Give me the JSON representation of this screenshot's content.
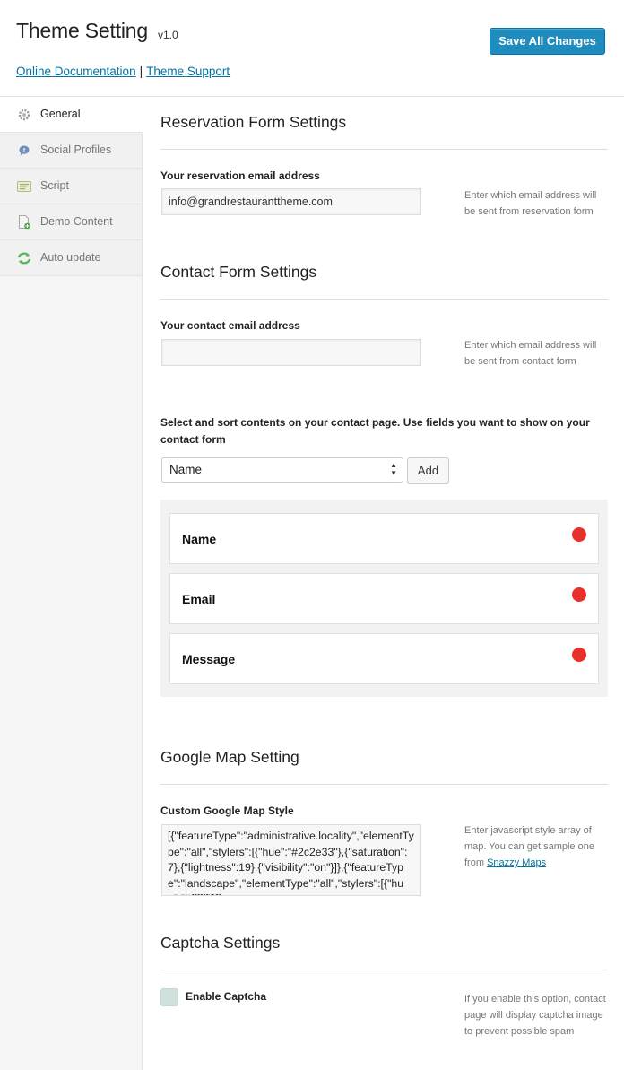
{
  "header": {
    "title": "Theme Setting",
    "version": "v1.0",
    "save_label": "Save All Changes",
    "doc_link": "Online Documentation",
    "separator": "|",
    "support_link": "Theme Support"
  },
  "sidebar": {
    "items": [
      {
        "label": "General",
        "icon": "gear-icon",
        "active": true
      },
      {
        "label": "Social Profiles",
        "icon": "social-bubble-icon",
        "active": false
      },
      {
        "label": "Script",
        "icon": "script-icon",
        "active": false
      },
      {
        "label": "Demo Content",
        "icon": "demo-content-icon",
        "active": false
      },
      {
        "label": "Auto update",
        "icon": "auto-update-icon",
        "active": false
      }
    ]
  },
  "reservation": {
    "title": "Reservation Form Settings",
    "email_label": "Your reservation email address",
    "email_value": "info@grandrestauranttheme.com",
    "help": "Enter which email address will be sent from reservation form"
  },
  "contact": {
    "title": "Contact Form Settings",
    "email_label": "Your contact email address",
    "email_value": "",
    "help": "Enter which email address will be sent from contact form",
    "sort_description": "Select and sort contents on your contact page. Use fields you want to show on your contact form",
    "select_value": "Name",
    "add_label": "Add",
    "fields": [
      "Name",
      "Email",
      "Message"
    ]
  },
  "map": {
    "title": "Google Map Setting",
    "style_label": "Custom Google Map Style",
    "style_value": "[{\"featureType\":\"administrative.locality\",\"elementType\":\"all\",\"stylers\":[{\"hue\":\"#2c2e33\"},{\"saturation\":7},{\"lightness\":19},{\"visibility\":\"on\"}]},{\"featureType\":\"landscape\",\"elementType\":\"all\",\"stylers\":[{\"hue\":\"#ffffff\"}]}",
    "help_text": "Enter javascript style array of map. You can get sample one from",
    "help_link": "Snazzy Maps"
  },
  "captcha": {
    "title": "Captcha Settings",
    "enable_label": "Enable Captcha",
    "help": "If you enable this option, contact page will display captcha image to prevent possible spam"
  },
  "colors": {
    "accent": "#1e8cbe",
    "link": "#0074a2",
    "remove": "#e8302a"
  }
}
